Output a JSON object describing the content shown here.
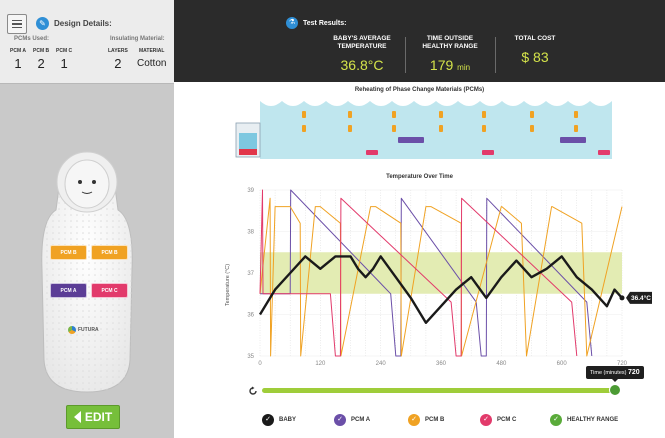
{
  "design": {
    "title": "Design Details:",
    "pcms_used_label": "PCMs Used:",
    "insulating_label": "Insulating Material:",
    "columns": [
      {
        "header": "PCM A",
        "value": "1"
      },
      {
        "header": "PCM B",
        "value": "2"
      },
      {
        "header": "PCM C",
        "value": "1"
      },
      {
        "header": "LAYERS",
        "value": "2"
      },
      {
        "header": "MATERIAL",
        "value": "Cotton"
      }
    ]
  },
  "bag": {
    "chips": [
      "PCM B",
      "PCM B",
      "PCM A",
      "PCM C"
    ],
    "brand": "FUTURA"
  },
  "edit_label": "EDIT",
  "results": {
    "title": "Test Results:",
    "stats": [
      {
        "header_line1": "BABY'S AVERAGE",
        "header_line2": "TEMPERATURE",
        "value": "36.8°C",
        "unit": ""
      },
      {
        "header_line1": "TIME OUTSIDE",
        "header_line2": "HEALTHY RANGE",
        "value": "179",
        "unit": "min"
      },
      {
        "header_line1": "TOTAL COST",
        "header_line2": "",
        "value": "$ 83",
        "unit": ""
      }
    ]
  },
  "reheat_title": "Reheating of Phase Change Materials (PCMs)",
  "reheat_machine_label": "Water",
  "chart": {
    "title": "Temperature Over Time",
    "ylabel": "Temperature (°C)",
    "current_value_label": "36.4°C",
    "y_ticks": [
      "35",
      "36",
      "37",
      "38",
      "39"
    ],
    "x_ticks": [
      "0",
      "120",
      "240",
      "360",
      "480",
      "600",
      "720"
    ]
  },
  "chart_data": {
    "type": "line",
    "title": "Temperature Over Time",
    "xlabel": "",
    "ylabel": "Temperature (°C)",
    "xlim": [
      0,
      720
    ],
    "ylim": [
      35,
      39
    ],
    "healthy_range": [
      36.5,
      37.5
    ],
    "series": [
      {
        "name": "BABY",
        "color": "#1a1a1a",
        "x": [
          0,
          30,
          60,
          90,
          120,
          150,
          180,
          195,
          210,
          225,
          240,
          270,
          300,
          330,
          360,
          390,
          420,
          450,
          480,
          510,
          540,
          570,
          600,
          630,
          660,
          690,
          705,
          720
        ],
        "y": [
          36.0,
          36.6,
          37.0,
          37.4,
          37.1,
          37.4,
          37.4,
          37.1,
          36.9,
          37.1,
          37.4,
          36.9,
          36.4,
          35.8,
          36.2,
          36.6,
          36.9,
          36.4,
          36.9,
          37.3,
          36.9,
          37.1,
          37.4,
          36.9,
          36.6,
          36.2,
          36.6,
          36.4
        ]
      },
      {
        "name": "PCM A",
        "color": "#6b4fa8",
        "x": [
          0,
          60,
          61,
          260,
          270,
          280,
          281,
          430,
          440,
          450,
          451,
          650,
          660
        ],
        "y": [
          36.5,
          36.5,
          39.0,
          36.5,
          35.0,
          35.0,
          38.8,
          36.3,
          35.0,
          35.0,
          38.8,
          36.3,
          35.0
        ]
      },
      {
        "name": "PCM B",
        "color": "#f0a223",
        "x": [
          0,
          20,
          21,
          30,
          60,
          80,
          81,
          110,
          120,
          160,
          161,
          220,
          230,
          280,
          281,
          330,
          340,
          400,
          401,
          480,
          481,
          520,
          530,
          580,
          581,
          640,
          650,
          720
        ],
        "y": [
          36.5,
          38.8,
          35.0,
          38.6,
          38.6,
          38.2,
          35.0,
          38.6,
          38.6,
          38.2,
          35.0,
          38.6,
          38.6,
          38.2,
          35.0,
          38.6,
          38.6,
          38.2,
          35.0,
          38.6,
          38.6,
          38.2,
          35.0,
          38.6,
          38.6,
          38.2,
          35.0,
          38.6
        ]
      },
      {
        "name": "PCM C",
        "color": "#e23a6b",
        "x": [
          0,
          5,
          6,
          140,
          150,
          160,
          161,
          380,
          390,
          400,
          401,
          620,
          630
        ],
        "y": [
          36.5,
          39.0,
          36.5,
          36.5,
          35.0,
          35.0,
          38.8,
          36.3,
          35.0,
          35.0,
          38.8,
          36.3,
          35.0
        ]
      },
      {
        "name": "HEALTHY RANGE",
        "color": "#c5dc6a",
        "x": [
          0,
          720
        ],
        "y": [
          37.5,
          37.5
        ]
      }
    ]
  },
  "slider": {
    "label": "Time (minutes)",
    "value": "720"
  },
  "legend": [
    {
      "label": "BABY",
      "color": "#1a1a1a"
    },
    {
      "label": "PCM A",
      "color": "#6b4fa8"
    },
    {
      "label": "PCM B",
      "color": "#f0a223"
    },
    {
      "label": "PCM C",
      "color": "#e23a6b"
    },
    {
      "label": "HEALTHY RANGE",
      "color": "#5aab3a"
    }
  ]
}
